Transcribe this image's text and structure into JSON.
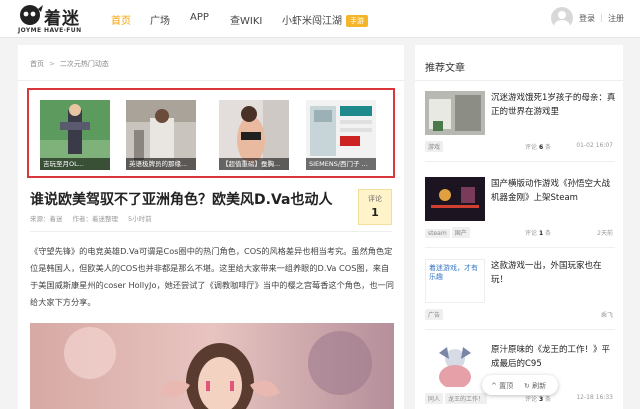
{
  "header": {
    "logo_cn": "着迷",
    "logo_en": "JOYME HAVE·FUN",
    "nav": [
      {
        "label": "首页",
        "active": true
      },
      {
        "label": "广场",
        "active": false
      },
      {
        "label": "APP",
        "active": false
      },
      {
        "label": "查WIKI",
        "active": false
      },
      {
        "label": "小虾米闯江湖",
        "active": false,
        "badge": "手游"
      }
    ],
    "login": "登录",
    "divider": "|",
    "register": "注册"
  },
  "breadcrumb": {
    "home": "首页",
    "sep": ">",
    "current": "二次元热门动态"
  },
  "gallery": [
    {
      "caption": "吉玩至月OL..."
    },
    {
      "caption": "英语极牌员的那缘..."
    },
    {
      "caption": "【超值重磅】蚕胸..."
    },
    {
      "caption": "SIEMENS/西门子 ..."
    }
  ],
  "article": {
    "title": "谁说欧美驾驭不了亚洲角色？欧美风D.Va也动人",
    "source": "来源：着迷",
    "author": "作者：着迷整理",
    "time": "5小时前",
    "comment_label": "评论",
    "comment_count": "1",
    "body": "《守望先锋》的电竞英雄D.Va可谓是Cos圈中的热门角色，COS的风格差异也相当考究。虽然角色定位是韩国人，但欧美人的COS也并非都是那么不堪。这里给大家带来一组养眼的D.Va COS图，来自于美国威斯康星州的coser HollyJo，她还尝试了《调教咖啡厅》当中的樱之宫莓香这个角色，也一同给大家下方分享。"
  },
  "sidebar": {
    "title": "推荐文章",
    "items": [
      {
        "title": "沉迷游戏饿死1岁孩子的母亲：真正的世界在游戏里",
        "tags": [
          "游戏"
        ],
        "comments_label": "评论",
        "comments": "6",
        "comments_unit": "条",
        "time": "01-02 16:07"
      },
      {
        "title": "国产横版动作游戏《孙悟空大战机器金刚》上架Steam",
        "tags": [
          "steam",
          "国产"
        ],
        "comments_label": "评论",
        "comments": "1",
        "comments_unit": "条",
        "time": "2天前"
      },
      {
        "title": "这款游戏一出，外国玩家也在玩！",
        "tags": [
          "广告"
        ],
        "comments_label": "",
        "comments": "",
        "comments_unit": "",
        "time": "乘飞"
      },
      {
        "title": "原汁原味的《龙王的工作！》平成最后的C95",
        "tags": [
          "同人",
          "龙王的工作！"
        ],
        "comments_label": "评论",
        "comments": "3",
        "comments_unit": "条",
        "time": "12-18 16:33"
      }
    ],
    "ad_image_text": "着迷游戏，才有乐趣"
  },
  "float_bar": {
    "top": "置顶",
    "refresh": "刷新"
  },
  "colors": {
    "accent": "#f5a100",
    "highlight_border": "#d9363e",
    "comment_bg": "#fff3c9"
  }
}
